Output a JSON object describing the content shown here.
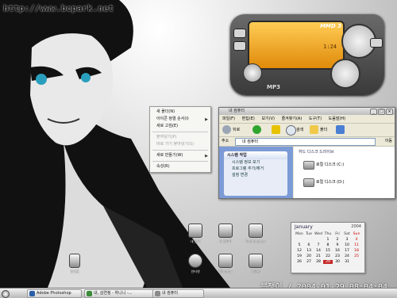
{
  "watermark": "http://www.bcpark.net",
  "player": {
    "logo": "MMD 3",
    "time": "1:24",
    "format": "MP3"
  },
  "context_menu": {
    "items": [
      {
        "label": "새 폴더(N)",
        "disabled": false,
        "submenu": false
      },
      {
        "label": "아이콘 정렬 순서(I)",
        "disabled": false,
        "submenu": true
      },
      {
        "label": "새로 고침(E)",
        "disabled": false,
        "submenu": false
      },
      {
        "label": "붙여넣기(P)",
        "disabled": true,
        "submenu": false
      },
      {
        "label": "바로 가기 붙여넣기(S)",
        "disabled": true,
        "submenu": false
      },
      {
        "label": "새로 만들기(W)",
        "disabled": false,
        "submenu": true
      },
      {
        "label": "속성(R)",
        "disabled": false,
        "submenu": false
      }
    ]
  },
  "explorer": {
    "title": "내 컴퓨터",
    "menubar": [
      "파일(F)",
      "편집(E)",
      "보기(V)",
      "즐겨찾기(A)",
      "도구(T)",
      "도움말(H)"
    ],
    "toolbar": {
      "back": "뒤로",
      "search": "검색",
      "folders": "폴더"
    },
    "address_label": "주소",
    "address_value": "내 컴퓨터",
    "go_label": "이동",
    "panel": {
      "title": "시스템 작업",
      "items": [
        "시스템 정보 보기",
        "프로그램 추가/제거",
        "설정 변경"
      ]
    },
    "group_header": "하드 디스크 드라이브",
    "drives": [
      "로컬 디스크 (C:)",
      "로컬 디스크 (D:)"
    ]
  },
  "desktop_icons": [
    {
      "label": "내 문서",
      "name": "my-documents-icon"
    },
    {
      "label": "내 컴퓨터",
      "name": "my-computer-icon"
    },
    {
      "label": "Konfabulator",
      "name": "konfabulator-icon"
    },
    {
      "label": "인터넷",
      "name": "internet-icon"
    },
    {
      "label": "Winamp",
      "name": "winamp-icon"
    },
    {
      "label": "제어판",
      "name": "control-panel-icon"
    },
    {
      "label": "휴지통",
      "name": "recycle-bin-icon"
    }
  ],
  "calendar": {
    "month": "January",
    "year": "2004",
    "day_names": [
      "Mon",
      "Tue",
      "Wed",
      "Thu",
      "Fri",
      "Sat",
      "Sun"
    ],
    "weeks": [
      [
        "",
        "",
        "",
        "1",
        "2",
        "3",
        "4"
      ],
      [
        "5",
        "6",
        "7",
        "8",
        "9",
        "10",
        "11"
      ],
      [
        "12",
        "13",
        "14",
        "15",
        "16",
        "17",
        "18"
      ],
      [
        "19",
        "20",
        "21",
        "22",
        "23",
        "24",
        "25"
      ],
      [
        "26",
        "27",
        "28",
        "29",
        "30",
        "31",
        ""
      ]
    ],
    "today": "29"
  },
  "clock_text": "붓쟁이 / 2004-01-29 08:04:04",
  "taskbar": {
    "buttons": [
      "Adobe Photoshop",
      "내, 김연정 - 하니니 -...",
      "내 컴퓨터"
    ]
  }
}
